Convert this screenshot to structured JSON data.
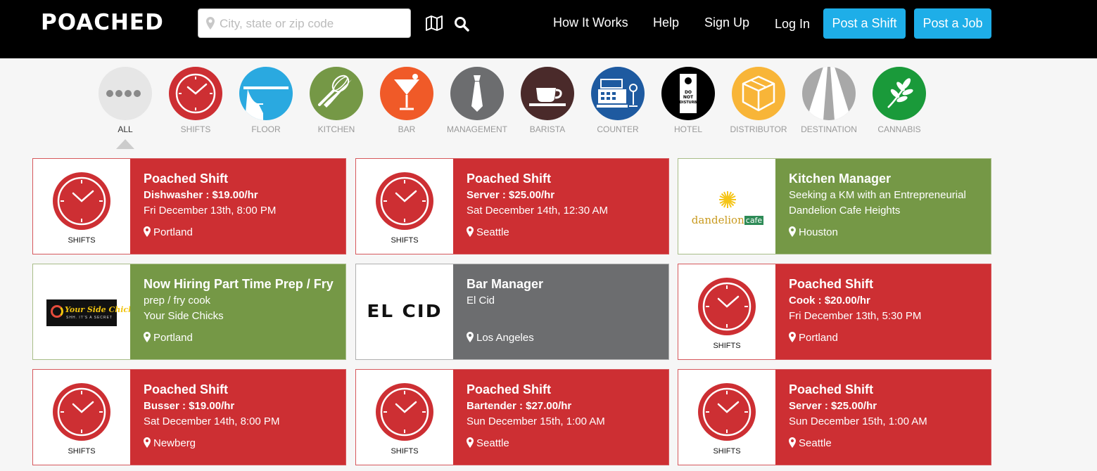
{
  "header": {
    "logo": "POACHED",
    "search_placeholder": "City, state or zip code",
    "icons": [
      "map-icon",
      "search-icon"
    ],
    "nav": [
      "How It Works",
      "Help",
      "Sign Up",
      "Log In"
    ],
    "buttons": [
      "Post a Shift",
      "Post a Job"
    ],
    "accent": "#1eaee8"
  },
  "categories": [
    {
      "label": "ALL",
      "color": "#e6e6e6",
      "active": true
    },
    {
      "label": "SHIFTS",
      "color": "#cd2f33"
    },
    {
      "label": "FLOOR",
      "color": "#2aa9e0"
    },
    {
      "label": "KITCHEN",
      "color": "#759846"
    },
    {
      "label": "BAR",
      "color": "#f05a28"
    },
    {
      "label": "MANAGEMENT",
      "color": "#6c6d6f"
    },
    {
      "label": "BARISTA",
      "color": "#4a2a2a"
    },
    {
      "label": "COUNTER",
      "color": "#1e5aa0"
    },
    {
      "label": "HOTEL",
      "color": "#000000"
    },
    {
      "label": "DISTRIBUTOR",
      "color": "#f8b538"
    },
    {
      "label": "DESTINATION",
      "color": "#a8a8a8"
    },
    {
      "label": "CANNABIS",
      "color": "#1a9a3a"
    }
  ],
  "listings": [
    {
      "type": "shift",
      "color": "red",
      "title": "Poached Shift",
      "line1": "Dishwasher : $19.00/hr",
      "line2": "Fri December 13th, 8:00 PM",
      "location": "Portland",
      "logo_label": "SHIFTS"
    },
    {
      "type": "shift",
      "color": "red",
      "title": "Poached Shift",
      "line1": "Server : $25.00/hr",
      "line2": "Sat December 14th, 12:30 AM",
      "location": "Seattle",
      "logo_label": "SHIFTS"
    },
    {
      "type": "job",
      "color": "green",
      "logo": "dandelion",
      "logo_text": "dandelion",
      "logo_text2": "cafe",
      "title": "Kitchen Manager",
      "line1": "Seeking a KM with an Entrepreneurial",
      "line2": "Dandelion Cafe Heights",
      "location": "Houston"
    },
    {
      "type": "job",
      "color": "green",
      "logo": "yoursidechicks",
      "logo_text": "Your Side Chicks",
      "logo_text2": "SHH. IT'S A SECRET",
      "title": "Now Hiring Part Time Prep / Fry",
      "line1": "prep / fry cook",
      "line2": "Your Side Chicks",
      "location": "Portland"
    },
    {
      "type": "job",
      "color": "gray",
      "logo": "elcid",
      "logo_text": "EL CID",
      "title": "Bar Manager",
      "line1": "El Cid",
      "line2": "",
      "location": "Los Angeles"
    },
    {
      "type": "shift",
      "color": "red",
      "title": "Poached Shift",
      "line1": "Cook : $20.00/hr",
      "line2": "Fri December 13th, 5:30 PM",
      "location": "Portland",
      "logo_label": "SHIFTS"
    },
    {
      "type": "shift",
      "color": "red",
      "title": "Poached Shift",
      "line1": "Busser : $19.00/hr",
      "line2": "Sat December 14th, 8:00 PM",
      "location": "Newberg",
      "logo_label": "SHIFTS"
    },
    {
      "type": "shift",
      "color": "red",
      "title": "Poached Shift",
      "line1": "Bartender : $27.00/hr",
      "line2": "Sun December 15th, 1:00 AM",
      "location": "Seattle",
      "logo_label": "SHIFTS"
    },
    {
      "type": "shift",
      "color": "red",
      "title": "Poached Shift",
      "line1": "Server : $25.00/hr",
      "line2": "Sun December 15th, 1:00 AM",
      "location": "Seattle",
      "logo_label": "SHIFTS"
    }
  ]
}
